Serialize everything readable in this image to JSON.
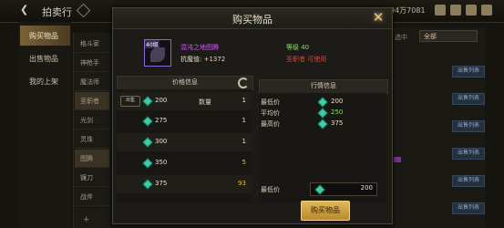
{
  "topbar": {
    "back_icon": "chevron-left-icon",
    "title": "拍卖行",
    "currency_text": "94万7081"
  },
  "sidebar": {
    "items": [
      {
        "label": "购买物品"
      },
      {
        "label": "出售物品"
      },
      {
        "label": "我的上架"
      }
    ]
  },
  "categories": {
    "items": [
      "格斗家",
      "神枪手",
      "魔法师",
      "圣职者",
      "光剑",
      "灵珠",
      "图腾",
      "镰刀",
      "战斧"
    ]
  },
  "right_bg": {
    "sell_buttons": [
      "出售列表",
      "出售列表",
      "出售列表",
      "出售列表",
      "出售列表",
      "出售列表"
    ],
    "dropdown_value": "全部",
    "dropdown_label": "选中"
  },
  "modal": {
    "title": "购买物品",
    "item": {
      "badge": "40级",
      "name": "混沌之地图腾",
      "stat": "抗魔值: +1372",
      "level": "等级 40",
      "class_req": "圣职者 可使用"
    },
    "price_panel": {
      "title": "价格信息",
      "sell_tag": "出售",
      "qty_label": "数量",
      "rows": [
        {
          "price": "200",
          "qty": "1"
        },
        {
          "price": "275",
          "qty": "1"
        },
        {
          "price": "300",
          "qty": "1"
        },
        {
          "price": "350",
          "qty": "5"
        },
        {
          "price": "375",
          "qty": "93"
        }
      ]
    },
    "market_panel": {
      "title": "行情信息",
      "rows": [
        {
          "label": "最低价",
          "value": "200"
        },
        {
          "label": "平均价",
          "value": "250"
        },
        {
          "label": "最高价",
          "value": "375"
        }
      ],
      "min_label": "最低价",
      "min_value": "200"
    },
    "buy_button": "购买物品"
  },
  "colors": {
    "accent_gold": "#e2b757",
    "item_name_purple": "#c45fe8",
    "level_green": "#8ddc6a",
    "class_red": "#d9452f",
    "gem": "#3bcfa8"
  }
}
